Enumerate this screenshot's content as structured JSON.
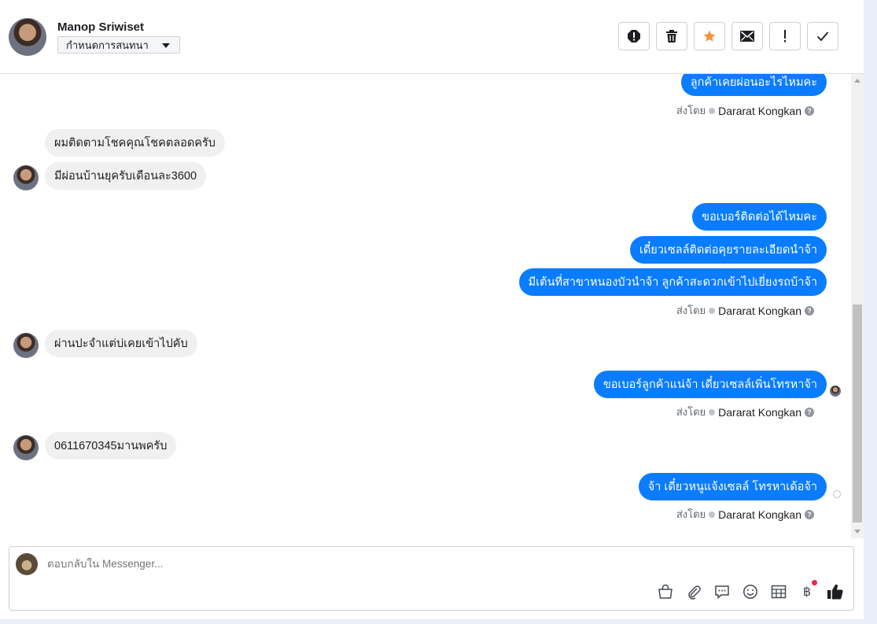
{
  "header": {
    "name": "Manop Sriwiset",
    "assign_label": "กำหนดการสนทนา",
    "toolbar": [
      "spam-icon",
      "delete-icon",
      "star-icon",
      "mark-unread-icon",
      "follow-up-icon",
      "done-icon"
    ]
  },
  "colors": {
    "outgoing": "#0a7cff",
    "incoming": "#f0f0f0",
    "star": "#f7923b"
  },
  "messages": {
    "m1": "ลูกค้าเคยผ่อนอะไรไหมคะ",
    "m2": "ผมติดตามโชคคุณโชคตลอดครับ",
    "m3": "มีผ่อนบ้านยุครับเดือนละ3600",
    "m4": "ขอเบอร์ติดต่อได้ไหมคะ",
    "m5": "เดี๋ยวเซลล์ติดต่อคุยรายละเอียดนำจ้า",
    "m6": "มีเต้นที่สาขาหนองบัวนำจ้า ลูกค้าสะดวกเข้าไปเยี่ยงรถบ้าจ้า",
    "m7": "ผ่านปะจำแต่บ่เคยเข้าไปคับ",
    "m8": "ขอเบอร์ลูกค้าแน่จ้า เดี๋ยวเซลล์เพิ่นโทรหาจ้า",
    "m9": "0611670345มานพครับ",
    "m10": "จ้า เดี๋ยวหนูแจ้งเซลล์ โทรหาเด้อจ้า"
  },
  "sent_by": {
    "prefix": "ส่งโดย",
    "name": "Dararat Kongkan",
    "help": "?"
  },
  "composer": {
    "placeholder": "ตอบกลับใน Messenger...",
    "icons": [
      "shop-icon",
      "attachment-icon",
      "saved-reply-icon",
      "emoji-icon",
      "table-icon",
      "baht-icon",
      "like-icon"
    ],
    "baht_symbol": "฿"
  }
}
